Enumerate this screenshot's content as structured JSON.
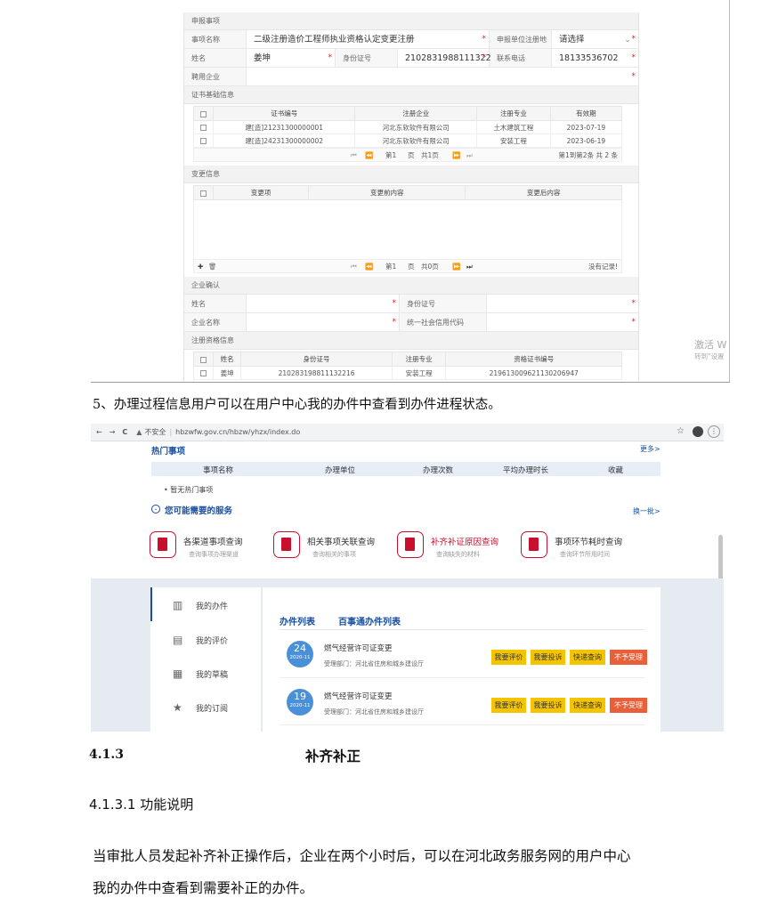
{
  "form": {
    "sec_apply": "申报事项",
    "item_label": "事项名称",
    "item_value": "二级注册造价工程师执业资格认定变更注册",
    "region_label": "申报单位注册地",
    "region_value": "请选择",
    "name_label": "姓名",
    "name_value": "姜坤",
    "id_label": "身份证号",
    "id_value": "2102831988111322",
    "phone_label": "联系电话",
    "phone_value": "18133536702",
    "employer_label": "聘用企业",
    "sec_cert": "证书基础信息",
    "cert_headers": [
      "证书编号",
      "注册企业",
      "注册专业",
      "有效期"
    ],
    "cert_rows": [
      [
        "建[造]21231300000001",
        "河北东软软件有限公司",
        "土木建筑工程",
        "2023-07-19"
      ],
      [
        "建[造]24231300000002",
        "河北东软软件有限公司",
        "安装工程",
        "2023-06-19"
      ]
    ],
    "pager1": {
      "page_prefix": "第1",
      "page_mid": "页",
      "page_total": "共1页",
      "summary": "第1到第2条  共 2 条"
    },
    "sec_change": "变更信息",
    "change_headers": [
      "变更项",
      "变更前内容",
      "变更后内容"
    ],
    "pager2": {
      "page_prefix": "第1",
      "page_mid": "页",
      "page_total": "共0页",
      "summary": "没有记录!"
    },
    "sec_confirm": "企业确认",
    "confirm_name_label": "姓名",
    "confirm_id_label": "身份证号",
    "company_label": "企业名称",
    "credit_label": "统一社会信用代码",
    "sec_reg": "注册资格信息",
    "reg_headers": [
      "姓名",
      "身份证号",
      "注册专业",
      "资格证书编号"
    ],
    "reg_row": [
      "姜坤",
      "210283198811132216",
      "安装工程",
      "219613009621130206947"
    ],
    "watermark1": "激活 W",
    "watermark2": "转到\"设置"
  },
  "caption5": "5、办理过程信息用户可以在用户中心我的办件中查看到办件进程状态。",
  "browser": {
    "back": "←",
    "forward": "→",
    "reload": "C",
    "insecure": "不安全",
    "url": "hbzwfw.gov.cn/hbzw/yhzx/index.do",
    "hot_title": "热门事项",
    "more": "更多>",
    "hot_headers": [
      "事项名称",
      "办理单位",
      "办理次数",
      "平均办理时长",
      "收藏"
    ],
    "no_hot": "• 暂无热门事项",
    "need_title": "您可能需要的服务",
    "change_batch": "换一批>",
    "services": [
      {
        "title": "各渠道事项查询",
        "sub": "查询事项办理渠道"
      },
      {
        "title": "相关事项关联查询",
        "sub": "查询相关的事项"
      },
      {
        "title": "补齐补证原因查询",
        "sub": "查询缺失的材料"
      },
      {
        "title": "事项环节耗时查询",
        "sub": "查询环节所用时间"
      }
    ],
    "menu": [
      "我的办件",
      "我的评价",
      "我的草稿",
      "我的订阅"
    ],
    "tabs": [
      "办件列表",
      "百事通办件列表"
    ],
    "items": [
      {
        "day": "24",
        "ym": "2020-11",
        "title": "燃气经营许可证变更",
        "dept": "受理部门：河北省住房和城乡建设厅"
      },
      {
        "day": "19",
        "ym": "2020-11",
        "title": "燃气经营许可证变更",
        "dept": "受理部门：河北省住房和城乡建设厅"
      }
    ],
    "actions": [
      "我要评价",
      "我要投诉",
      "快递查询",
      "不予受理"
    ]
  },
  "heading_num": "4.1.3",
  "heading_title": "补齐补正",
  "sub_heading": "4.1.3.1 功能说明",
  "para_line1": "当审批人员发起补齐补正操作后，企业在两个小时后，可以在河北政务服务网的用户中心",
  "para_line2": "我的办件中查看到需要补正的办件。"
}
